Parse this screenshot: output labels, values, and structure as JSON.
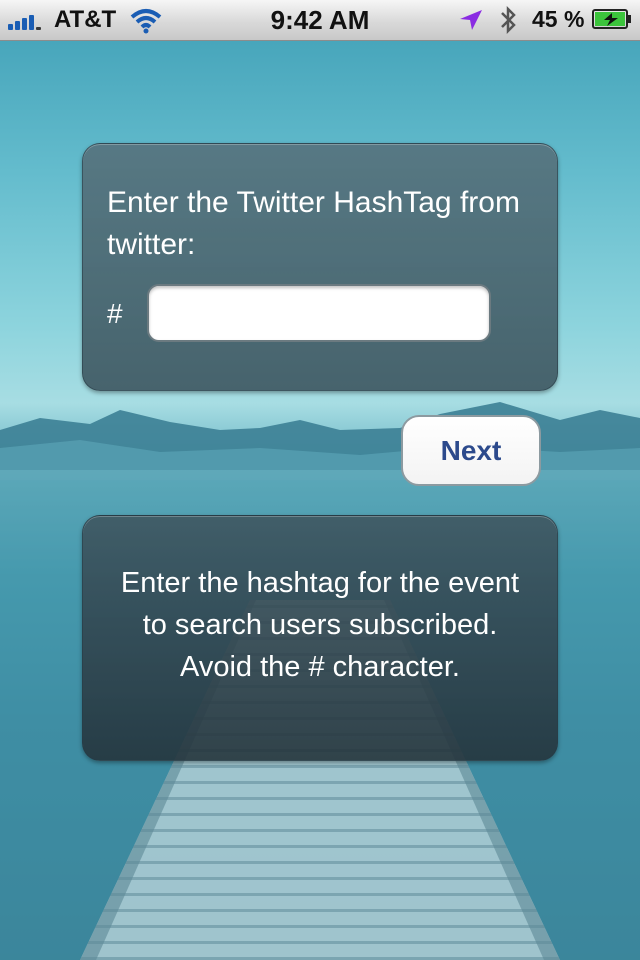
{
  "status_bar": {
    "carrier": "AT&T",
    "time": "9:42 AM",
    "battery": "45 %",
    "icons": [
      "signal-bars-icon",
      "wifi-icon",
      "location-arrow-icon",
      "bluetooth-icon",
      "battery-charging-icon"
    ]
  },
  "hashtag_panel": {
    "prompt": "Enter the Twitter HashTag from twitter:",
    "hash_symbol": "#",
    "input_value": "",
    "input_placeholder": ""
  },
  "next_button": {
    "label": "Next"
  },
  "help_panel": {
    "text": "Enter the hashtag for the event to search users subscribed. Avoid the # character."
  },
  "colors": {
    "status_bar": "#d9d9d9",
    "panel": "#3a525c",
    "button_text": "#2c4a8c",
    "signal": "#1a5db4",
    "location": "#8a2be2",
    "battery": "#3cc43c"
  }
}
